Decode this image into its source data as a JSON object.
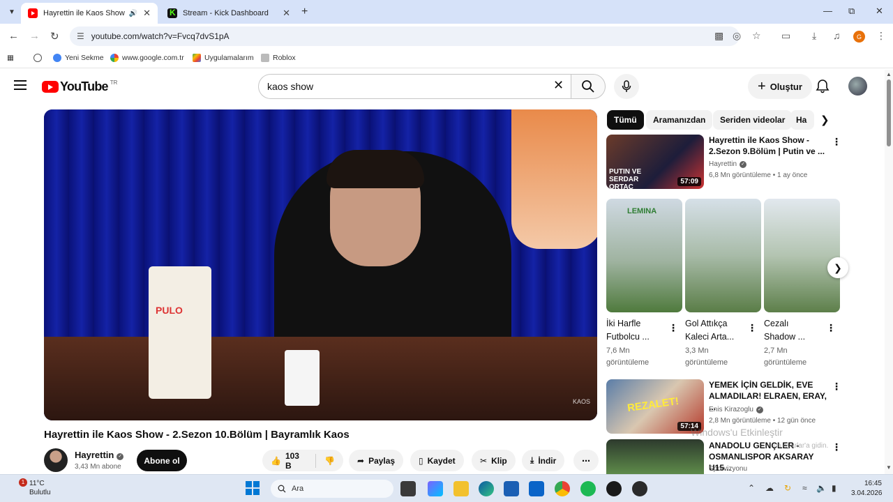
{
  "browser": {
    "tabs": [
      {
        "title": "Hayrettin ile Kaos Show - 2",
        "active": true
      },
      {
        "title": "Stream - Kick Dashboard",
        "active": false
      }
    ],
    "url": "youtube.com/watch?v=Fvcq7dvS1pA",
    "profile_initial": "G",
    "bookmarks": [
      "Yeni Sekme",
      "www.google.com.tr",
      "Uygulamalarım",
      "Roblox"
    ]
  },
  "youtube": {
    "logo_text": "YouTube",
    "country_code": "TR",
    "search_value": "kaos show",
    "create_label": "Oluştur"
  },
  "video": {
    "title": "Hayrettin ile Kaos Show - 2.Sezon 10.Bölüm | Bayramlık Kaos",
    "channel": "Hayrettin",
    "subscribers": "3,43 Mn abone",
    "subscribe_label": "Abone ol",
    "likes": "103 B",
    "share_label": "Paylaş",
    "save_label": "Kaydet",
    "clip_label": "Klip",
    "download_label": "İndir",
    "frame_text": {
      "bag_brand": "PULO",
      "watermark": "KAOS"
    }
  },
  "chips": [
    "Tümü",
    "Aramanızdan",
    "Seriden videolar",
    "Ha"
  ],
  "recommendations": [
    {
      "title_line1": "Hayrettin ile Kaos Show -",
      "title_line2": "2.Sezon 9.Bölüm | Putin ve ...",
      "channel": "Hayrettin",
      "meta": "6,8 Mn görüntüleme • 1 ay önce",
      "duration": "57:09",
      "thumb_text": "PUTIN VE SERDAR ORTAÇ"
    },
    {
      "title_line1": "YEMEK İÇİN GELDİK, EVE",
      "title_line2": "ALMADILAR! ELRAEN, ERAY, ...",
      "channel": "Enis Kirazoglu",
      "meta": "2,8 Mn görüntüleme • 12 gün önce",
      "duration": "57:14",
      "thumb_text": "REZALET!"
    },
    {
      "title_line1": "ANADOLU GENÇLER -",
      "title_line2": "OSMANLISPOR AKSARAY U15...",
      "channel": "Sporvizyonu",
      "meta": "",
      "duration": "",
      "thumb_text": ""
    }
  ],
  "shorts": [
    {
      "title_line1": "İki Harfle",
      "title_line2": "Futbolcu ...",
      "views_line1": "7,6 Mn",
      "views_line2": "görüntüleme",
      "thumb_text": "LEMINA"
    },
    {
      "title_line1": "Gol Attıkça",
      "title_line2": "Kaleci Arta...",
      "views_line1": "3,3 Mn",
      "views_line2": "görüntüleme",
      "thumb_text": ""
    },
    {
      "title_line1": "Cezalı",
      "title_line2": "Shadow ...",
      "views_line1": "2,7 Mn",
      "views_line2": "görüntüleme",
      "thumb_text": ""
    }
  ],
  "overlay": {
    "activate_line1": "Windows'u Etkinleştir",
    "activate_line2": "...un Ayarlar'a gidin."
  },
  "taskbar": {
    "weather_temp": "11°C",
    "weather_desc": "Bulutlu",
    "weather_badge": "1",
    "search_placeholder": "Ara",
    "time": "16:45",
    "date": "3.04.2026"
  },
  "colors": {
    "yt_red": "#ff0000",
    "accent_blue": "#0078d4",
    "chrome_bg": "#d6e2f9"
  }
}
